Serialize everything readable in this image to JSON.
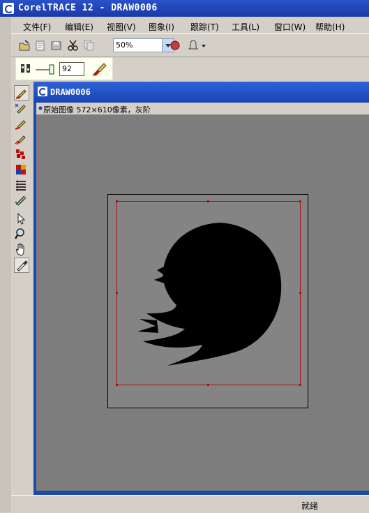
{
  "window": {
    "title": "CorelTRACE 12 - DRAW0006"
  },
  "menu": {
    "items": [
      "文件(F)",
      "编辑(E)",
      "视图(V)",
      "图象(I)",
      "跟踪(T)",
      "工具(L)",
      "窗口(W)",
      "帮助(H)"
    ]
  },
  "toolbar": {
    "zoom_value": "50%",
    "icons": [
      "open-icon",
      "import-icon",
      "save-icon",
      "cut-icon",
      "copy-icon",
      "record-icon",
      "bell-icon"
    ]
  },
  "trace_toolbar": {
    "threshold_value": "92",
    "icons": [
      "filter-icon",
      "slider-icon",
      "trace-pen-icon"
    ]
  },
  "side_tools": [
    "trace-outline-icon",
    "trace-centerline-icon",
    "trace-pen-icon",
    "trace-sketch-icon",
    "mosaic-icon",
    "cubes-icon",
    "woodcut-icon",
    "ocr-icon",
    "select-pointer-icon",
    "zoom-icon",
    "hand-icon",
    "eyedropper-icon"
  ],
  "document": {
    "title": "DRAW0006",
    "info": "原始图像  572×610像素，灰阶"
  },
  "status": {
    "text": "就绪"
  },
  "colors": {
    "titlebar": "#1a3aa8",
    "canvas_bg": "#7d7d7d",
    "selection": "#b01010"
  }
}
